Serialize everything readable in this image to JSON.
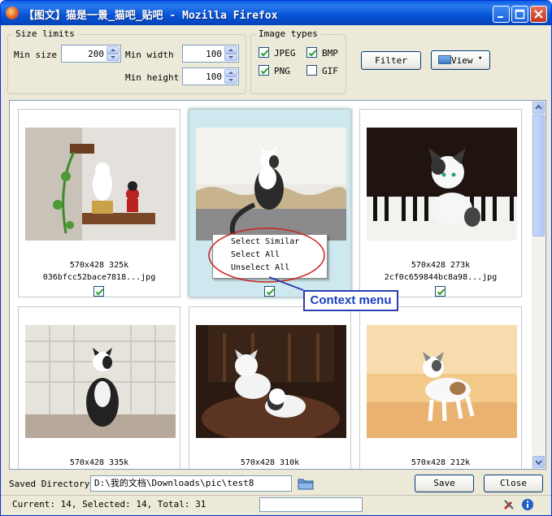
{
  "window": {
    "title": "【图文】猫是一景_猫吧_贴吧 - Mozilla Firefox"
  },
  "size_limits": {
    "legend": "Size limits",
    "min_size_label": "Min size",
    "min_size_value": "200",
    "min_width_label": "Min width",
    "min_width_value": "100",
    "min_height_label": "Min height",
    "min_height_value": "100"
  },
  "image_types": {
    "legend": "Image types",
    "jpeg": "JPEG",
    "bmp": "BMP",
    "png": "PNG",
    "gif": "GIF",
    "checked": {
      "jpeg": true,
      "bmp": true,
      "png": true,
      "gif": false
    }
  },
  "toolbar": {
    "filter_label": "Filter",
    "view_label": "View"
  },
  "images": [
    {
      "dims": "570x428",
      "size": "325k",
      "name": "036bfcc52bace7818...jpg",
      "checked": true
    },
    {
      "dims": "",
      "size": "",
      "name": "",
      "checked": true
    },
    {
      "dims": "570x428",
      "size": "273k",
      "name": "2cf0c659844bc8a98...jpg",
      "checked": true
    },
    {
      "dims": "570x428",
      "size": "335k",
      "name": "",
      "checked": true
    },
    {
      "dims": "570x428",
      "size": "310k",
      "name": "",
      "checked": true
    },
    {
      "dims": "570x428",
      "size": "212k",
      "name": "",
      "checked": true
    }
  ],
  "context_menu": {
    "items": [
      "Select Similar",
      "Select All",
      "Unselect All"
    ]
  },
  "callout": "Context menu",
  "bottom": {
    "saved_dir_label": "Saved Directory",
    "saved_dir_value": "D:\\我的文档\\Downloads\\pic\\test8",
    "save_label": "Save",
    "close_label": "Close"
  },
  "status": {
    "text": "Current: 14, Selected: 14, Total: 31"
  }
}
